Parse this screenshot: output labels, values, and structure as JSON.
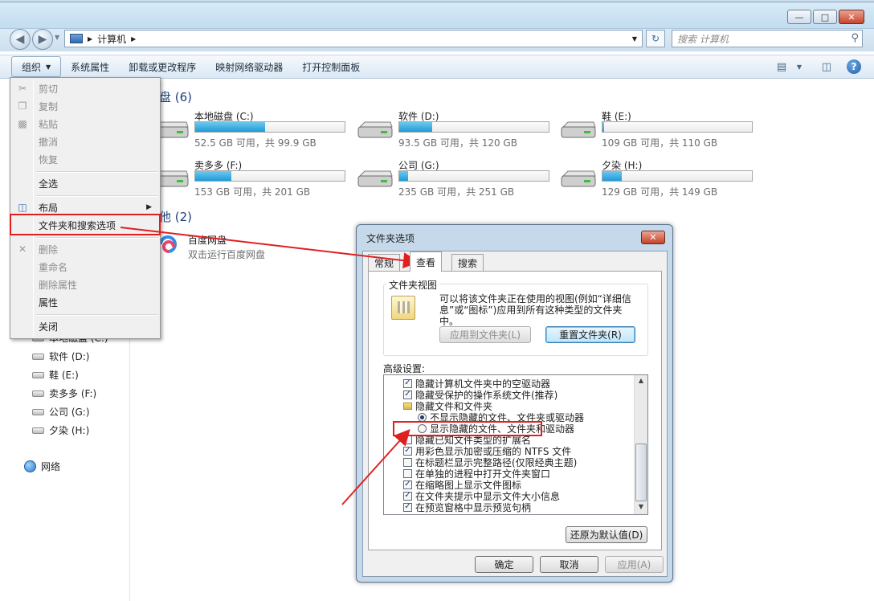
{
  "address": {
    "crumb": "计算机",
    "search_placeholder": "搜索 计算机"
  },
  "toolbar": {
    "items": [
      "组织",
      "系统属性",
      "卸载或更改程序",
      "映射网络驱动器",
      "打开控制面板"
    ]
  },
  "content": {
    "group_drives": "盘 (6)",
    "group_other": "他 (2)",
    "drives": [
      {
        "name": "本地磁盘 (C:)",
        "info": "52.5 GB 可用，共 99.9 GB",
        "used_fraction": 0.47
      },
      {
        "name": "软件 (D:)",
        "info": "93.5 GB 可用，共 120 GB",
        "used_fraction": 0.22
      },
      {
        "name": "鞋 (E:)",
        "info": "109 GB 可用，共 110 GB",
        "used_fraction": 0.01
      },
      {
        "name": "卖多多 (F:)",
        "info": "153 GB 可用，共 201 GB",
        "used_fraction": 0.24
      },
      {
        "name": "公司 (G:)",
        "info": "235 GB 可用，共 251 GB",
        "used_fraction": 0.06
      },
      {
        "name": "夕染 (H:)",
        "info": "129 GB 可用，共 149 GB",
        "used_fraction": 0.13
      }
    ],
    "other": {
      "name": "百度网盘",
      "desc": "双击运行百度网盘"
    }
  },
  "navpane": {
    "items": [
      "本地磁盘 (C:)",
      "软件 (D:)",
      "鞋 (E:)",
      "卖多多 (F:)",
      "公司 (G:)",
      "夕染 (H:)"
    ],
    "network": "网络"
  },
  "menu": {
    "items": [
      {
        "label": "剪切",
        "enabled": false
      },
      {
        "label": "复制",
        "enabled": false
      },
      {
        "label": "粘贴",
        "enabled": false
      },
      {
        "label": "撤消",
        "enabled": false
      },
      {
        "label": "恢复",
        "enabled": false
      },
      {
        "label": "全选",
        "enabled": true
      },
      {
        "label": "布局",
        "enabled": true
      },
      {
        "label": "文件夹和搜索选项",
        "enabled": true
      },
      {
        "label": "删除",
        "enabled": false
      },
      {
        "label": "重命名",
        "enabled": false
      },
      {
        "label": "删除属性",
        "enabled": false
      },
      {
        "label": "属性",
        "enabled": true
      },
      {
        "label": "关闭",
        "enabled": true
      }
    ]
  },
  "dialog": {
    "title": "文件夹选项",
    "tabs": [
      "常规",
      "查看",
      "搜索"
    ],
    "folder_views": {
      "legend": "文件夹视图",
      "desc": "可以将该文件夹正在使用的视图(例如“详细信息”或“图标”)应用到所有这种类型的文件夹中。",
      "apply_button": "应用到文件夹(L)",
      "reset_button": "重置文件夹(R)"
    },
    "advanced_label": "高级设置:",
    "advanced_items": [
      {
        "kind": "checkbox",
        "checked": true,
        "label": "隐藏计算机文件夹中的空驱动器"
      },
      {
        "kind": "checkbox",
        "checked": true,
        "label": "隐藏受保护的操作系统文件(推荐)"
      },
      {
        "kind": "folder",
        "label": "隐藏文件和文件夹"
      },
      {
        "kind": "radio",
        "checked": true,
        "label": "不显示隐藏的文件、文件夹或驱动器"
      },
      {
        "kind": "radio",
        "checked": false,
        "label": "显示隐藏的文件、文件夹和驱动器"
      },
      {
        "kind": "checkbox",
        "checked": false,
        "label": "隐藏已知文件类型的扩展名"
      },
      {
        "kind": "checkbox",
        "checked": true,
        "label": "用彩色显示加密或压缩的 NTFS 文件"
      },
      {
        "kind": "checkbox",
        "checked": false,
        "label": "在标题栏显示完整路径(仅限经典主题)"
      },
      {
        "kind": "checkbox",
        "checked": false,
        "label": "在单独的进程中打开文件夹窗口"
      },
      {
        "kind": "checkbox",
        "checked": true,
        "label": "在缩略图上显示文件图标"
      },
      {
        "kind": "checkbox",
        "checked": true,
        "label": "在文件夹提示中显示文件大小信息"
      },
      {
        "kind": "checkbox",
        "checked": true,
        "label": "在预览窗格中显示预览句柄"
      }
    ],
    "restore_button": "还原为默认值(D)",
    "ok_button": "确定",
    "cancel_button": "取消",
    "apply_button": "应用(A)"
  },
  "colors": {
    "annotation": "#e02020",
    "drive_bar": "#1e9bd7",
    "group_header": "#1e3f7a"
  }
}
